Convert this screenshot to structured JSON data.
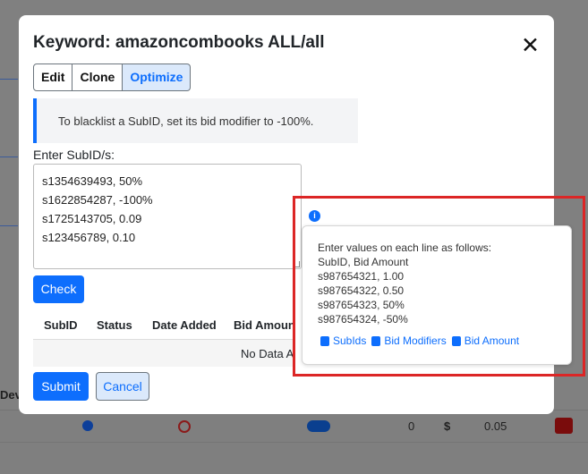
{
  "modal": {
    "title": "Keyword: amazoncombooks ALL/all",
    "close": "✕",
    "tabs": [
      {
        "label": "Edit"
      },
      {
        "label": "Clone"
      },
      {
        "label": "Optimize"
      }
    ],
    "alert": "To blacklist a SubID, set its bid modifier to -100%.",
    "subid_label": "Enter SubID/s:",
    "subid_lines": [
      "s1354639493, 50%",
      "s1622854287, -100%",
      "s1725143705, 0.09",
      "s123456789, 0.10"
    ],
    "check_button": "Check",
    "table": {
      "headers": [
        "SubID",
        "Status",
        "Date Added",
        "Bid Amount"
      ],
      "empty": "No Data Available"
    },
    "submit_button": "Submit",
    "cancel_button": "Cancel"
  },
  "popover": {
    "lines": [
      "Enter values on each line as follows:",
      "SubID, Bid Amount",
      "s987654321, 1.00",
      "s987654322, 0.50",
      "s987654323, 50%",
      "s987654324, -50%"
    ],
    "links": [
      {
        "label": "SubIds",
        "icon": "book-icon"
      },
      {
        "label": "Bid Modifiers",
        "icon": "book-icon"
      },
      {
        "label": "Bid Amount",
        "icon": "book-icon"
      }
    ]
  },
  "background": {
    "row_values": [
      "0",
      "$",
      "0.05"
    ],
    "col_fragment": "Devi"
  },
  "colors": {
    "primary": "#0d6efd",
    "highlight": "#dc2626"
  }
}
